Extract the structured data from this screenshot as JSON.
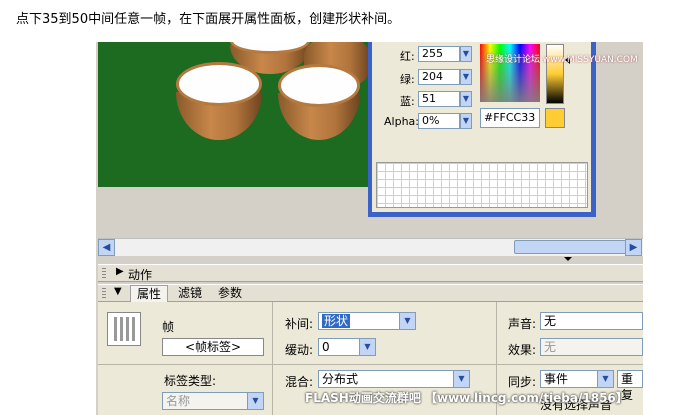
{
  "instruction": "点下35到50中间任意一帧，在下面展开属性面板，创建形状补间。",
  "color_dialog": {
    "red_label": "红:",
    "red_value": "255",
    "green_label": "绿:",
    "green_value": "204",
    "blue_label": "蓝:",
    "blue_value": "51",
    "alpha_label": "Alpha:",
    "alpha_value": "0%",
    "hex_value": "#FFCC33",
    "current_color": "#FFCC33"
  },
  "watermark_top": "思缘设计论坛 www.MISSYUAN.COM",
  "panels": {
    "actions_title": "动作",
    "tabs": [
      "属性",
      "滤镜",
      "参数"
    ]
  },
  "properties": {
    "frame_label": "帧",
    "frame_label_button": "<帧标签>",
    "label_type_label": "标签类型:",
    "label_type_value": "名称",
    "tween_label": "补间:",
    "tween_value": "形状",
    "ease_label": "缓动:",
    "ease_value": "0",
    "blend_label": "混合:",
    "blend_value": "分布式",
    "sound_label": "声音:",
    "sound_value": "无",
    "effect_label": "效果:",
    "effect_value": "无",
    "sync_label": "同步:",
    "sync_value": "事件",
    "repeat_value": "重复",
    "no_sound_selected": "没有选择声音"
  },
  "watermark_bottom": "FLASH动画交流群吧 【www.lincg.com/tieba/1856】"
}
